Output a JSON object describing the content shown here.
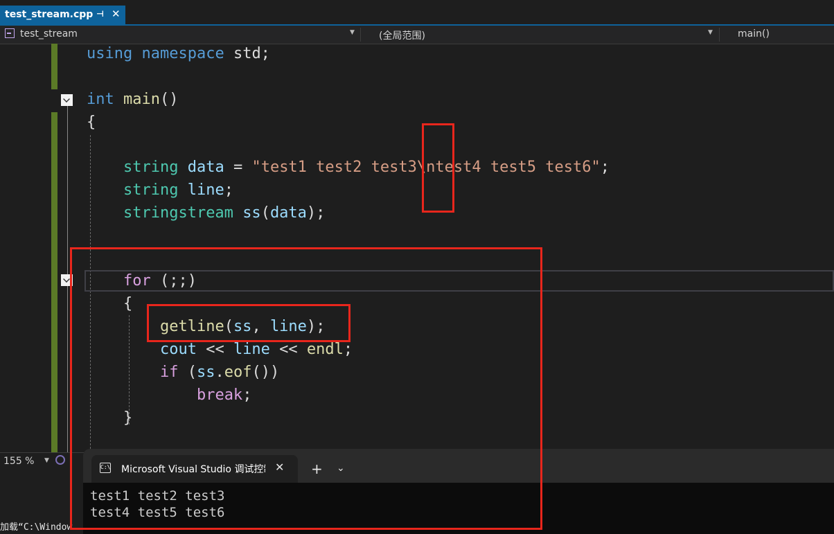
{
  "tab": {
    "filename": "test_stream.cpp",
    "pin_icon": "pin-icon",
    "close_icon": "close-icon"
  },
  "navbar": {
    "project": "test_stream",
    "scope": "(全局范围)",
    "member": "main()"
  },
  "code": {
    "lines": [
      {
        "id": "l1",
        "tokens": [
          [
            "kw",
            "using"
          ],
          [
            "pl",
            " "
          ],
          [
            "kw",
            "namespace"
          ],
          [
            "pl",
            " std;"
          ]
        ]
      },
      {
        "id": "l2",
        "tokens": [
          [
            "kw",
            "int"
          ],
          [
            "pl",
            " "
          ],
          [
            "fn",
            "main"
          ],
          [
            "pl",
            "()"
          ]
        ]
      },
      {
        "id": "l3",
        "tokens": [
          [
            "pl",
            "{"
          ]
        ]
      },
      {
        "id": "l4",
        "tokens": [
          [
            "pl",
            "    "
          ],
          [
            "ty",
            "string"
          ],
          [
            "pl",
            " "
          ],
          [
            "var",
            "data"
          ],
          [
            "pl",
            " = "
          ],
          [
            "str",
            "\"test1 test2 test3\\ntest4 test5 test6\""
          ],
          [
            "pl",
            ";"
          ]
        ]
      },
      {
        "id": "l5",
        "tokens": [
          [
            "pl",
            "    "
          ],
          [
            "ty",
            "string"
          ],
          [
            "pl",
            " "
          ],
          [
            "var",
            "line"
          ],
          [
            "pl",
            ";"
          ]
        ]
      },
      {
        "id": "l6",
        "tokens": [
          [
            "pl",
            "    "
          ],
          [
            "ty",
            "stringstream"
          ],
          [
            "pl",
            " "
          ],
          [
            "var",
            "ss"
          ],
          [
            "pl",
            "("
          ],
          [
            "var",
            "data"
          ],
          [
            "pl",
            ");"
          ]
        ]
      },
      {
        "id": "l7",
        "tokens": [
          [
            "pl",
            "    "
          ],
          [
            "ctl",
            "for"
          ],
          [
            "pl",
            " (;;)"
          ]
        ]
      },
      {
        "id": "l8",
        "tokens": [
          [
            "pl",
            "    {"
          ]
        ]
      },
      {
        "id": "l9",
        "tokens": [
          [
            "pl",
            "        "
          ],
          [
            "fn",
            "getline"
          ],
          [
            "pl",
            "("
          ],
          [
            "var",
            "ss"
          ],
          [
            "pl",
            ", "
          ],
          [
            "var",
            "line"
          ],
          [
            "pl",
            ");"
          ]
        ]
      },
      {
        "id": "l10",
        "tokens": [
          [
            "pl",
            "        "
          ],
          [
            "var",
            "cout"
          ],
          [
            "pl",
            " << "
          ],
          [
            "var",
            "line"
          ],
          [
            "pl",
            " << "
          ],
          [
            "fn",
            "endl"
          ],
          [
            "pl",
            ";"
          ]
        ]
      },
      {
        "id": "l11",
        "tokens": [
          [
            "pl",
            "        "
          ],
          [
            "ctl",
            "if"
          ],
          [
            "pl",
            " ("
          ],
          [
            "var",
            "ss"
          ],
          [
            "pl",
            "."
          ],
          [
            "fn",
            "eof"
          ],
          [
            "pl",
            "())"
          ]
        ]
      },
      {
        "id": "l12",
        "tokens": [
          [
            "pl",
            "            "
          ],
          [
            "ctl",
            "break"
          ],
          [
            "pl",
            ";"
          ]
        ]
      },
      {
        "id": "l13",
        "tokens": [
          [
            "pl",
            "    }"
          ]
        ]
      }
    ]
  },
  "statusbar": {
    "zoom": "155 %"
  },
  "output": {
    "text": "加载“C:\\Window"
  },
  "terminal": {
    "title": "Microsoft Visual Studio 调试控制台",
    "output_lines": [
      "test1 test2 test3",
      "test4 test5 test6"
    ]
  },
  "colors": {
    "accent": "#0e639c",
    "highlight_box": "#e8261c",
    "change_bar": "#5b7a27"
  }
}
